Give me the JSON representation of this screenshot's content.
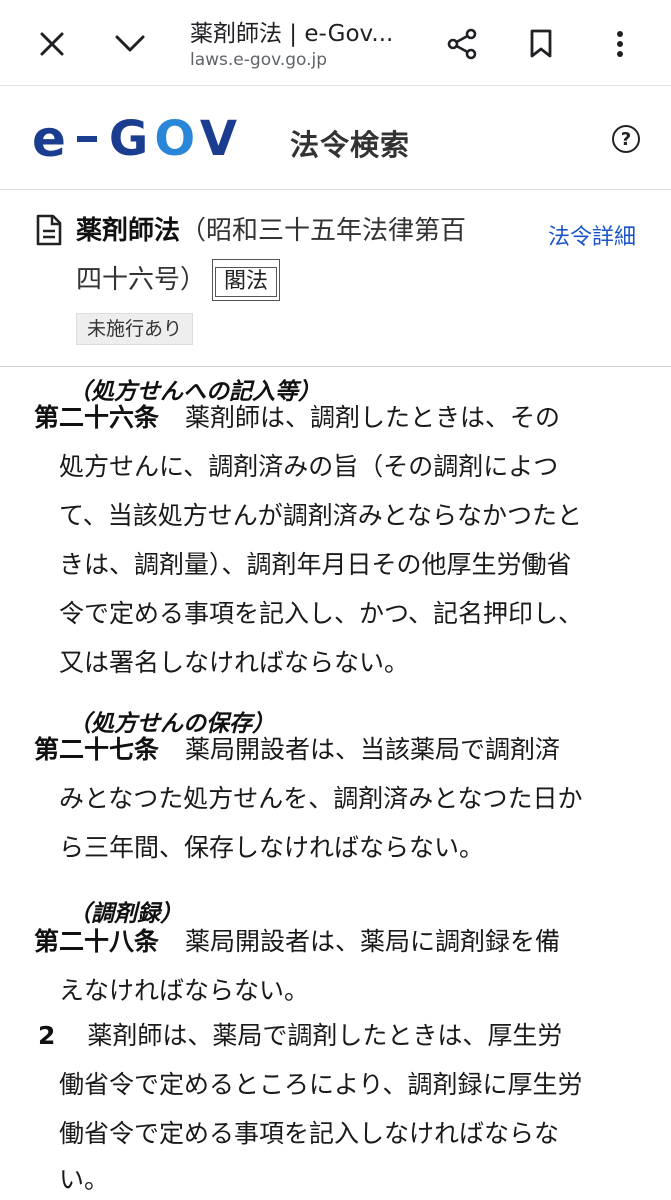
{
  "browser": {
    "title": "薬剤師法 | e-Gov...",
    "url": "laws.e-gov.go.jp",
    "icons": [
      "close-icon",
      "chevron-down-icon",
      "share-icon",
      "bookmark-icon",
      "more-vert-icon"
    ]
  },
  "header": {
    "logo_e": "e",
    "logo_gov": [
      "G",
      "O",
      "V"
    ],
    "site_name": "法令検索",
    "help_label": "?"
  },
  "law": {
    "name": "薬剤師法",
    "number_line1": "（昭和三十五年法律第百",
    "number_line2": "四十六号）",
    "type": "閣法",
    "detail_link": "法令詳細",
    "status": "未施行あり"
  },
  "articles": [
    {
      "caption": "（処方せんへの記入等）",
      "number": "第二十六条",
      "lines": [
        "薬剤師は、調剤したときは、その",
        "処方せんに、調剤済みの旨（その調剤によつ",
        "て、当該処方せんが調剤済みとならなかつたと",
        "きは、調剤量）、調剤年月日その他厚生労働省",
        "令で定める事項を記入し、かつ、記名押印し、",
        "又は署名しなければならない。"
      ]
    },
    {
      "caption": "（処方せんの保存）",
      "number": "第二十七条",
      "lines": [
        "薬局開設者は、当該薬局で調剤済",
        "みとなつた処方せんを、調剤済みとなつた日か",
        "ら三年間、保存しなければならない。"
      ]
    },
    {
      "caption": "（調剤録）",
      "number": "第二十八条",
      "lines": [
        "薬局開設者は、薬局に調剤録を備",
        "えなければならない。"
      ],
      "paragraphs": [
        {
          "number": "2",
          "lines": [
            "薬剤師は、薬局で調剤したときは、厚生労",
            "働省令で定めるところにより、調剤録に厚生労",
            "働省令で定める事項を記入しなければならな",
            "い。"
          ]
        }
      ]
    }
  ]
}
